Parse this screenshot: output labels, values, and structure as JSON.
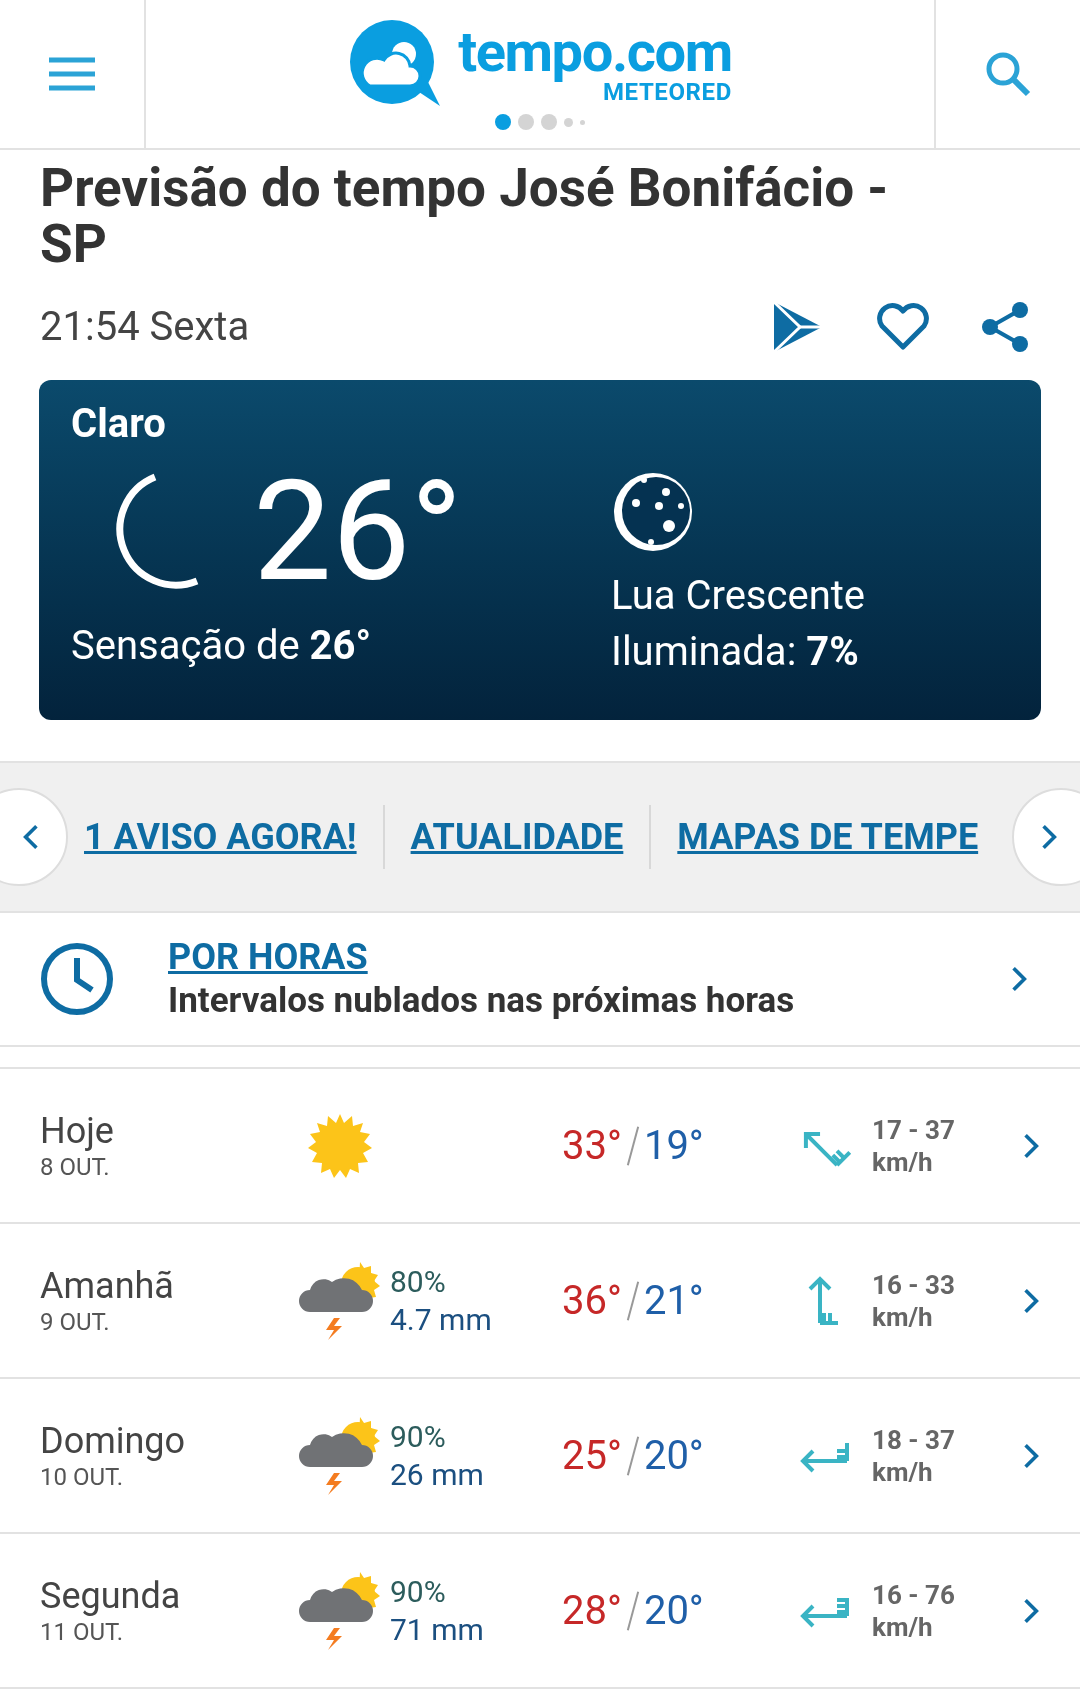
{
  "header": {
    "logo_name": "tempo.com",
    "logo_sub": "METEORED",
    "pager": [
      {
        "selected": true
      },
      {
        "selected": false
      },
      {
        "selected": false
      },
      {
        "selected": false
      },
      {
        "selected": false
      }
    ]
  },
  "title": "Previsão do tempo José Bonifácio - SP",
  "time": "21:54 Sexta",
  "current": {
    "condition": "Claro",
    "temperature": "26°",
    "feels_like": "Sensação de **26°**",
    "moon_phase": "Lua Crescente",
    "illuminated": "Iluminada: **7%**"
  },
  "nav_links": [
    "1 AVISO AGORA!",
    "ATUALIDADE",
    "MAPAS DE TEMPE"
  ],
  "hourly": {
    "link": "POR HORAS",
    "summary": "Intervalos nublados nas próximas horas"
  },
  "days": [
    {
      "day": "Hoje",
      "date": "8 OUT.",
      "kind": "sun",
      "max": "33°",
      "min": "19°",
      "wind_icon": {
        "kind": "northwest-moderate"
      },
      "wind": "17 - 37",
      "wind_unit": "km/h"
    },
    {
      "day": "Amanhã",
      "date": "9 OUT.",
      "kind": "storm",
      "chance": "80%",
      "rain": "4.7 mm",
      "max": "36°",
      "min": "21°",
      "wind_icon": {
        "kind": "north-moderate"
      },
      "wind": "16 - 33",
      "wind_unit": "km/h"
    },
    {
      "day": "Domingo",
      "date": "10 OUT.",
      "kind": "storm",
      "chance": "90%",
      "rain": "26 mm",
      "max": "25°",
      "min": "20°",
      "wind_icon": {
        "kind": "west-moderate"
      },
      "wind": "18 - 37",
      "wind_unit": "km/h"
    },
    {
      "day": "Segunda",
      "date": "11 OUT.",
      "kind": "storm",
      "chance": "90%",
      "rain": "71 mm",
      "max": "28°",
      "min": "20°",
      "wind_icon": {
        "kind": "west-strong"
      },
      "wind": "16 - 76",
      "wind_unit": "km/h"
    }
  ]
}
